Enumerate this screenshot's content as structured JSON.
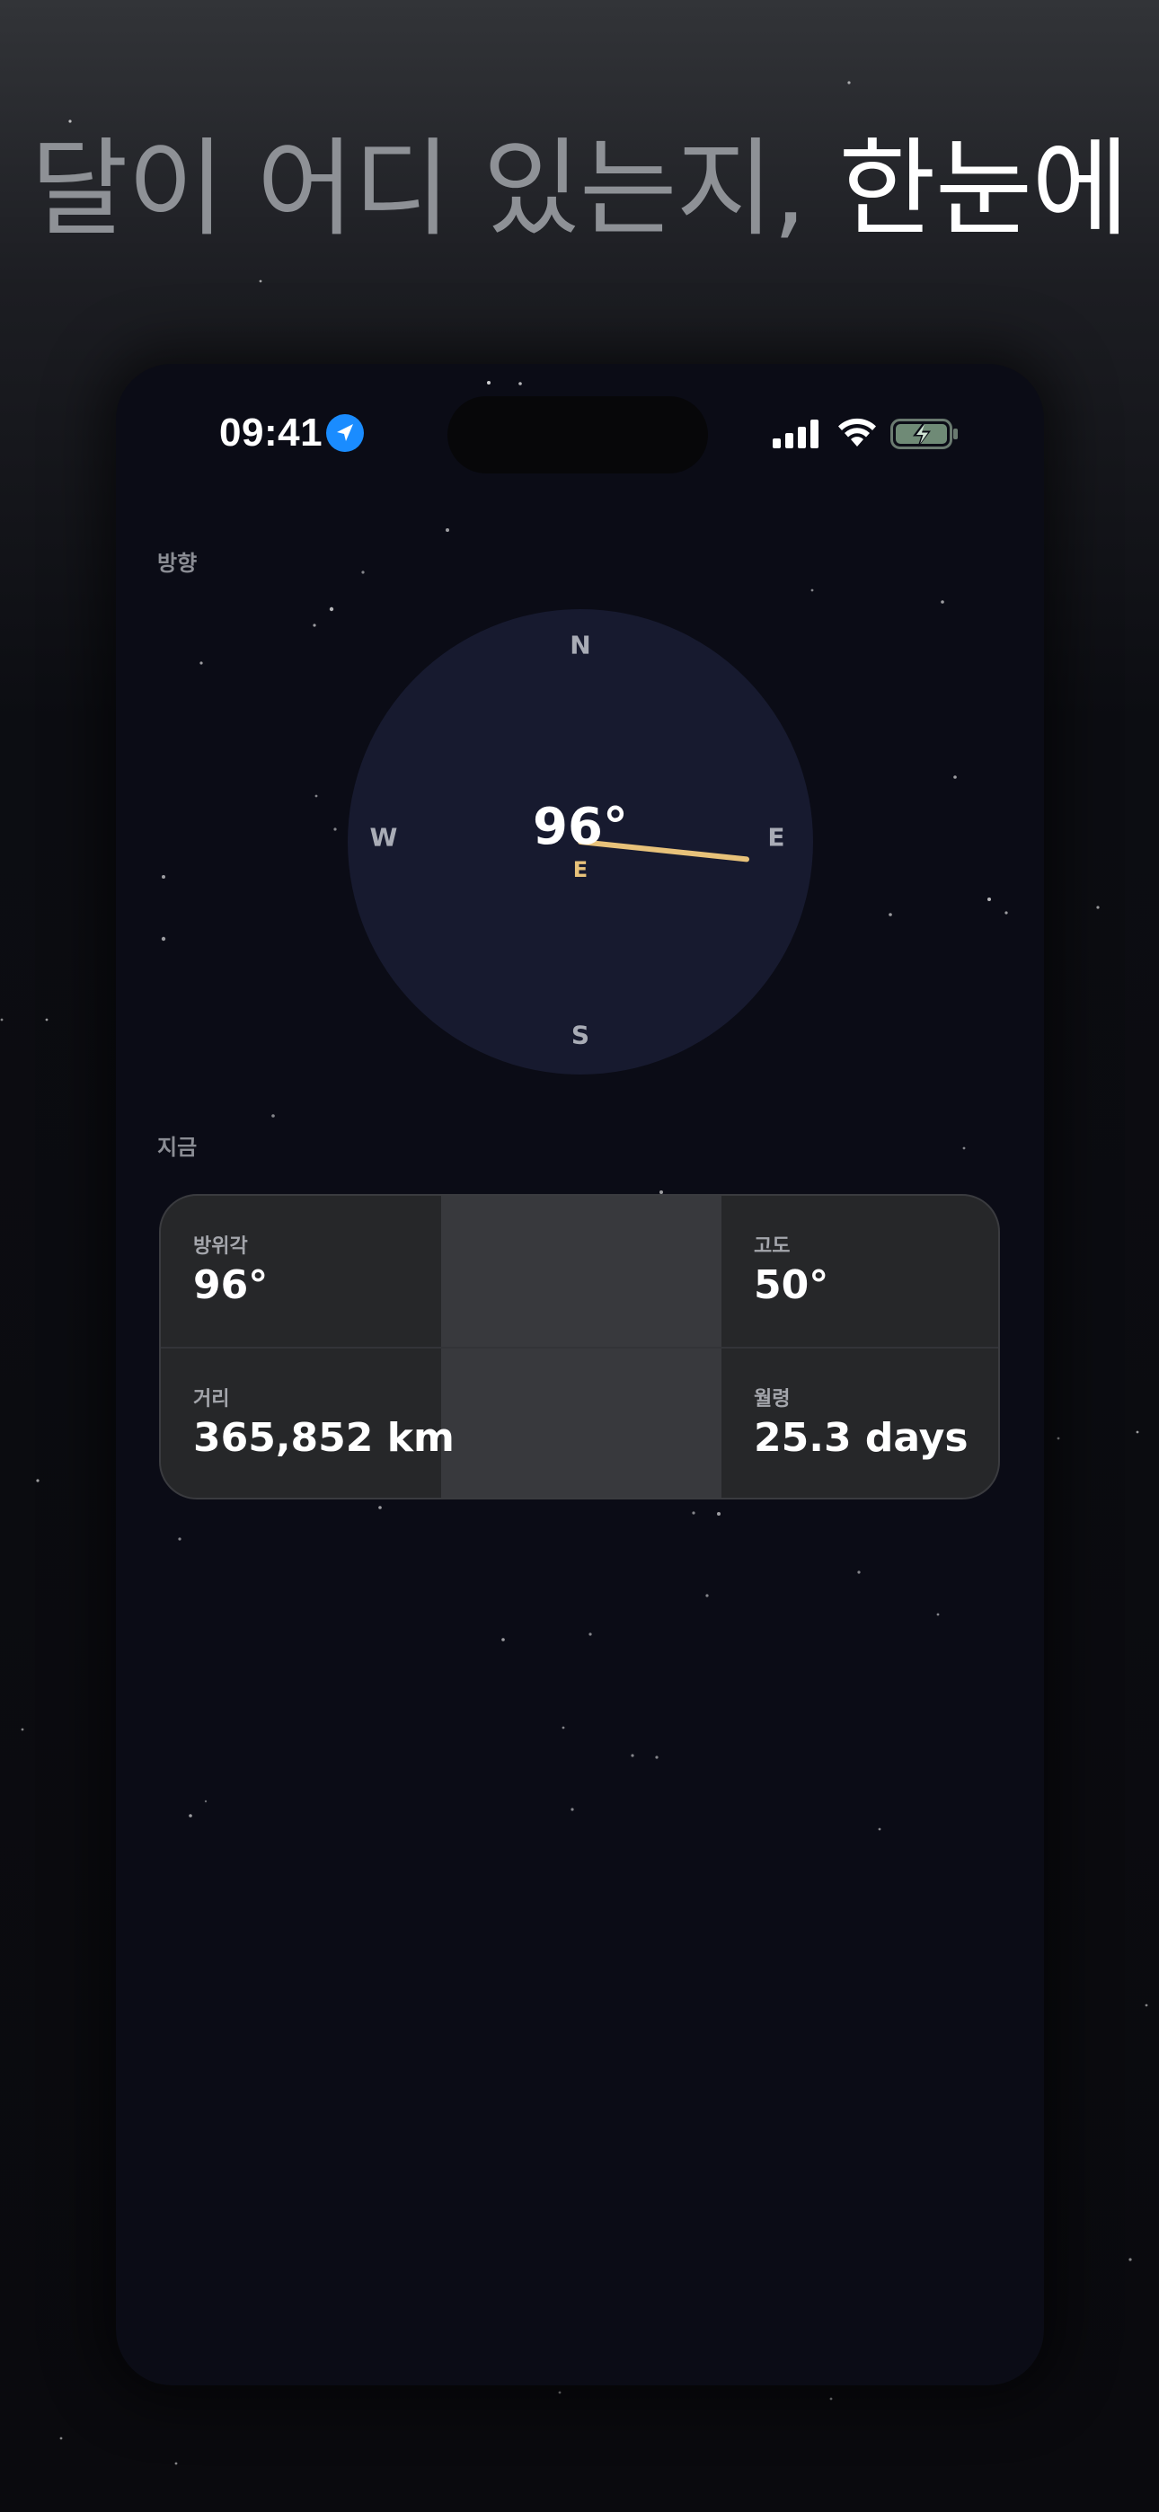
{
  "headline": {
    "dim": "달이 어디 있는지, ",
    "bright": "한눈에"
  },
  "status_bar": {
    "time": "09:41",
    "location_icon": "location-arrow-icon",
    "signal_icon": "cellular-signal-icon",
    "wifi_icon": "wifi-icon",
    "battery_icon": "battery-charging-icon"
  },
  "direction_section": {
    "label": "방향",
    "compass": {
      "north": "N",
      "east": "E",
      "south": "S",
      "west": "W",
      "heading_value": "96°",
      "heading_direction": "E",
      "heading_degrees": 96
    }
  },
  "now_section": {
    "label": "지금",
    "stats": [
      {
        "label": "방위각",
        "value": "96°"
      },
      {
        "label": "고도",
        "value": "50°"
      },
      {
        "label": "거리",
        "value": "365,852 km"
      },
      {
        "label": "월령",
        "value": "25.3 days"
      }
    ]
  },
  "colors": {
    "accent_needle": "#e8c27a",
    "location_blue": "#1a8cff",
    "dial": "#171a2f",
    "screen_bg": "#0b0c16"
  }
}
